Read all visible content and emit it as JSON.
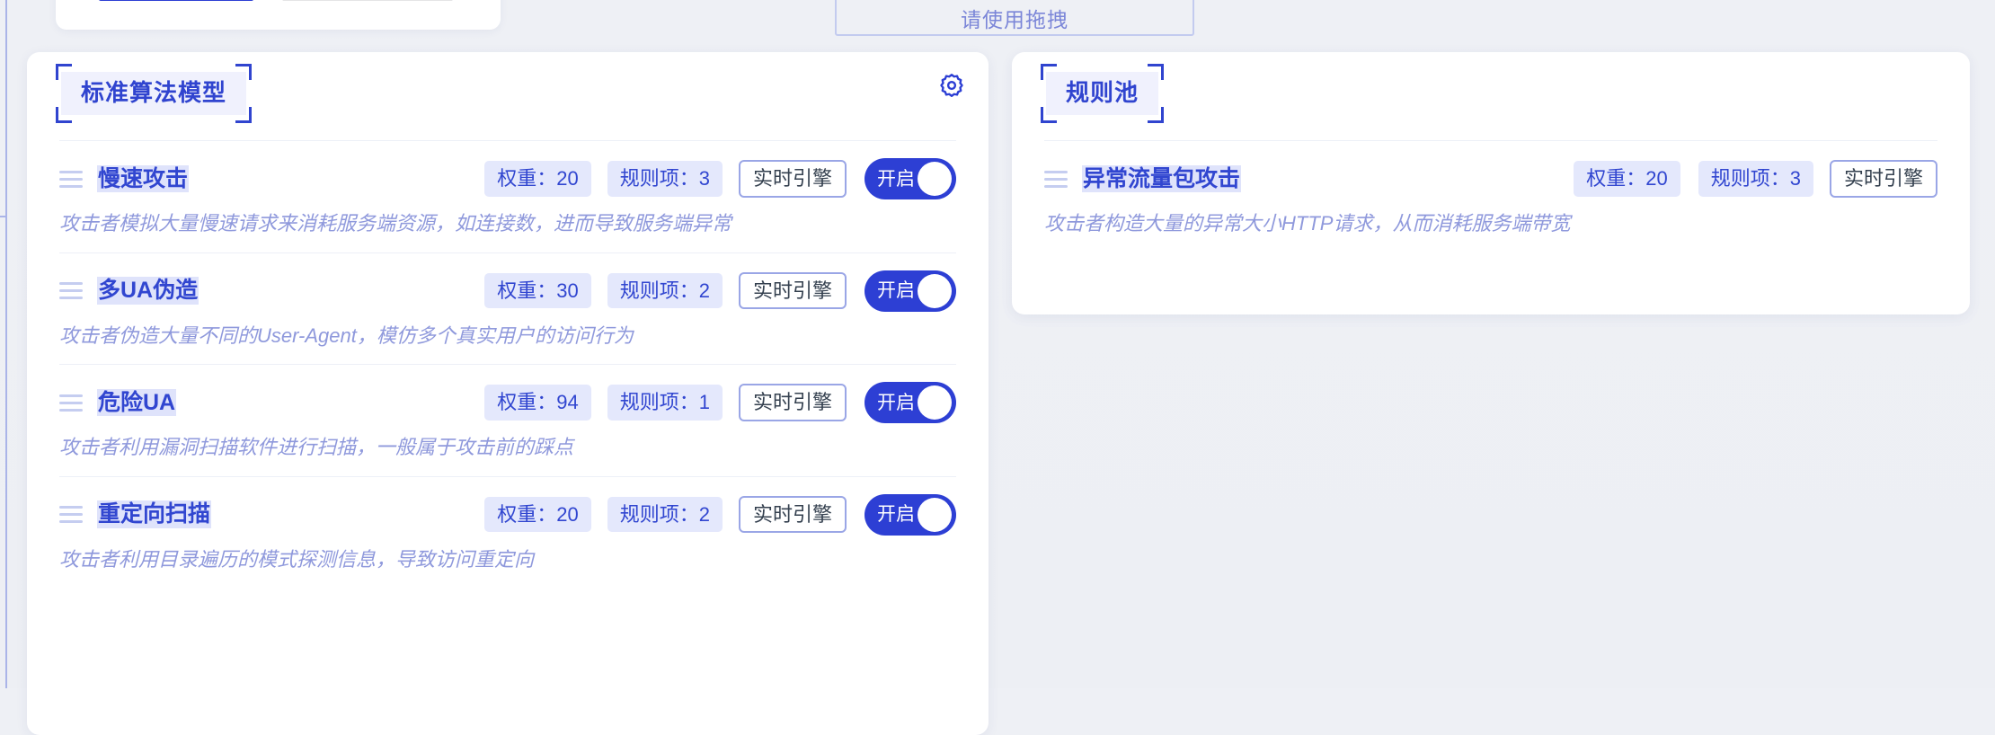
{
  "hint": {
    "drag_text": "请使用拖拽"
  },
  "top_card": {
    "active_tab": "",
    "inactive_tab": ""
  },
  "colors": {
    "accent": "#2d3fd4",
    "accent_text": "#3146d0",
    "chip_bg": "#e4e8fc",
    "title_bg": "#f0f1fd",
    "desc_text": "#8f99dc",
    "page_bg": "#eef0f5",
    "handle": "#c5cdf0",
    "outline_border": "#9aa6e6"
  },
  "left_panel": {
    "title": "标准算法模型",
    "settings_icon": "gear-icon",
    "rows": [
      {
        "handle_icon": "drag-handle-icon",
        "name": "慢速攻击",
        "weight_label": "权重：20",
        "rules_label": "规则项：3",
        "engine_label": "实时引擎",
        "toggle_label": "开启",
        "toggle_on": true,
        "description": "攻击者模拟大量慢速请求来消耗服务端资源，如连接数，进而导致服务端异常"
      },
      {
        "handle_icon": "drag-handle-icon",
        "name": "多UA伪造",
        "weight_label": "权重：30",
        "rules_label": "规则项：2",
        "engine_label": "实时引擎",
        "toggle_label": "开启",
        "toggle_on": true,
        "description": "攻击者伪造大量不同的User-Agent，模仿多个真实用户的访问行为"
      },
      {
        "handle_icon": "drag-handle-icon",
        "name": "危险UA",
        "weight_label": "权重：94",
        "rules_label": "规则项：1",
        "engine_label": "实时引擎",
        "toggle_label": "开启",
        "toggle_on": true,
        "description": "攻击者利用漏洞扫描软件进行扫描，一般属于攻击前的踩点"
      },
      {
        "handle_icon": "drag-handle-icon",
        "name": "重定向扫描",
        "weight_label": "权重：20",
        "rules_label": "规则项：2",
        "engine_label": "实时引擎",
        "toggle_label": "开启",
        "toggle_on": true,
        "description": "攻击者利用目录遍历的模式探测信息，导致访问重定向"
      }
    ]
  },
  "right_panel": {
    "title": "规则池",
    "rows": [
      {
        "handle_icon": "drag-handle-icon",
        "name": "异常流量包攻击",
        "weight_label": "权重：20",
        "rules_label": "规则项：3",
        "engine_label": "实时引擎",
        "description": "攻击者构造大量的异常大小HTTP请求，从而消耗服务端带宽"
      }
    ]
  }
}
